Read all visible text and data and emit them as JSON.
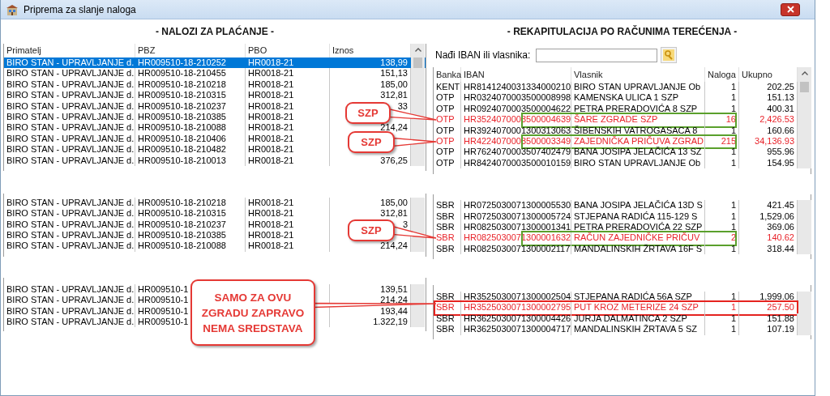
{
  "window": {
    "title": "Priprema za slanje naloga"
  },
  "payments": {
    "heading": "- NALOZI ZA PLAĆANJE -",
    "columns": [
      "Primatelj",
      "PBZ",
      "PBO",
      "Iznos"
    ],
    "strips": [
      {
        "rows": [
          {
            "primatelj": "BIRO STAN - UPRAVLJANJE d.",
            "pbz": "HR009510-18-210252",
            "pbo": "HR0018-21",
            "iznos": "138,99",
            "selected": true
          },
          {
            "primatelj": "BIRO STAN - UPRAVLJANJE d.",
            "pbz": "HR009510-18-210455",
            "pbo": "HR0018-21",
            "iznos": "151,13",
            "selected": false
          },
          {
            "primatelj": "BIRO STAN - UPRAVLJANJE d.",
            "pbz": "HR009510-18-210218",
            "pbo": "HR0018-21",
            "iznos": "185,00",
            "selected": false
          },
          {
            "primatelj": "BIRO STAN - UPRAVLJANJE d.",
            "pbz": "HR009510-18-210315",
            "pbo": "HR0018-21",
            "iznos": "312,81",
            "selected": false
          },
          {
            "primatelj": "BIRO STAN - UPRAVLJANJE d.",
            "pbz": "HR009510-18-210237",
            "pbo": "HR0018-21",
            "iznos": "33",
            "selected": false
          },
          {
            "primatelj": "BIRO STAN - UPRAVLJANJE d.",
            "pbz": "HR009510-18-210385",
            "pbo": "HR0018-21",
            "selected": false
          },
          {
            "primatelj": "BIRO STAN - UPRAVLJANJE d.",
            "pbz": "HR009510-18-210088",
            "pbo": "HR0018-21",
            "iznos": "214,24",
            "selected": false
          },
          {
            "primatelj": "BIRO STAN - UPRAVLJANJE d.",
            "pbz": "HR009510-18-210406",
            "pbo": "HR0018-21",
            "selected": false
          },
          {
            "primatelj": "BIRO STAN - UPRAVLJANJE d.",
            "pbz": "HR009510-18-210482",
            "pbo": "HR0018-21",
            "selected": false
          },
          {
            "primatelj": "BIRO STAN - UPRAVLJANJE d.",
            "pbz": "HR009510-18-210013",
            "pbo": "HR0018-21",
            "iznos": "376,25",
            "selected": false
          }
        ]
      },
      {
        "rows": [
          {
            "primatelj": "BIRO STAN - UPRAVLJANJE d.",
            "pbz": "HR009510-18-210218",
            "pbo": "HR0018-21",
            "iznos": "185,00",
            "selected": false
          },
          {
            "primatelj": "BIRO STAN - UPRAVLJANJE d.",
            "pbz": "HR009510-18-210315",
            "pbo": "HR0018-21",
            "iznos": "312,81",
            "selected": false
          },
          {
            "primatelj": "BIRO STAN - UPRAVLJANJE d.",
            "pbz": "HR009510-18-210237",
            "pbo": "HR0018-21",
            "iznos": "3",
            "selected": false
          },
          {
            "primatelj": "BIRO STAN - UPRAVLJANJE d.",
            "pbz": "HR009510-18-210385",
            "pbo": "HR0018-21",
            "selected": false
          },
          {
            "primatelj": "BIRO STAN - UPRAVLJANJE d.",
            "pbz": "HR009510-18-210088",
            "pbo": "HR0018-21",
            "iznos": "214,24",
            "selected": false
          }
        ]
      },
      {
        "rows": [
          {
            "primatelj": "BIRO STAN - UPRAVLJANJE d.",
            "pbz": "HR009510-1",
            "iznos": "139,51",
            "selected": false
          },
          {
            "primatelj": "BIRO STAN - UPRAVLJANJE d.",
            "pbz": "HR009510-1",
            "iznos": "214,24",
            "selected": false
          },
          {
            "primatelj": "BIRO STAN - UPRAVLJANJE d.",
            "pbz": "HR009510-1",
            "iznos": "193,44",
            "selected": false
          },
          {
            "primatelj": "BIRO STAN - UPRAVLJANJE d.",
            "pbz": "HR009510-1",
            "iznos": "1.322,19",
            "selected": false
          }
        ]
      }
    ]
  },
  "recap": {
    "heading": "- REKAPITULACIJA PO RAČUNIMA TEREĆENJA -",
    "search": {
      "label": "Nađi IBAN ili vlasnika:"
    },
    "columns": [
      "Banka",
      "IBAN",
      "Vlasnik",
      "Naloga",
      "Ukupno"
    ],
    "strips": [
      {
        "rows": [
          {
            "banka": "KENT",
            "iban": "HR8141240031334000210",
            "vlasnik": "BIRO STAN  UPRAVLJANJE Ob",
            "naloga": "1",
            "ukupno": "202.25",
            "flagged": false
          },
          {
            "banka": "OTP",
            "iban": "HR0324070003500008998",
            "vlasnik": "KAMENSKA ULICA 1 SZP",
            "naloga": "1",
            "ukupno": "151.13",
            "flagged": false
          },
          {
            "banka": "OTP",
            "iban": "HR0924070003500004622",
            "vlasnik": "PETRA PRERADOVIĆA 8 SZP",
            "naloga": "1",
            "ukupno": "400.31",
            "flagged": false
          },
          {
            "banka": "OTP",
            "iban": "HR3524070003500004639",
            "vlasnik": "ŠARE ZGRADE SZP",
            "naloga": "16",
            "ukupno": "2,426.53",
            "flagged": true,
            "color": "#5aa02c",
            "frame_whole": false
          },
          {
            "banka": "OTP",
            "iban": "HR3924070001300313063",
            "vlasnik": "ŠIBENSKIH VATROGASACA 8",
            "naloga": "1",
            "ukupno": "160.66",
            "flagged": false
          },
          {
            "banka": "OTP",
            "iban": "HR4224070003500003349",
            "vlasnik": "ZAJEDNIČKA PRIČUVA ZGRAD",
            "naloga": "215",
            "ukupno": "34,136.93",
            "flagged": true,
            "color": "#5aa02c",
            "frame_whole": false
          },
          {
            "banka": "OTP",
            "iban": "HR7624070003507402479",
            "vlasnik": "BANA JOSIPA JELAČIĆA 13 SZ",
            "naloga": "1",
            "ukupno": "955.96",
            "flagged": false
          },
          {
            "banka": "OTP",
            "iban": "HR8424070003500010159",
            "vlasnik": "BIRO STAN  UPRAVLJANJE Ob",
            "naloga": "1",
            "ukupno": "154.95",
            "flagged": false
          }
        ]
      },
      {
        "rows": [
          {
            "banka": "SBR",
            "iban": "HR0725030071300005530",
            "vlasnik": "BANA JOSIPA JELAČIĆA 13D S",
            "naloga": "1",
            "ukupno": "421.45",
            "flagged": false
          },
          {
            "banka": "SBR",
            "iban": "HR0725030071300005724",
            "vlasnik": "STJEPANA RADIĆA 115-129 S",
            "naloga": "1",
            "ukupno": "1,529.06",
            "flagged": false
          },
          {
            "banka": "SBR",
            "iban": "HR0825030071300001341",
            "vlasnik": "PETRA PRERADOVIĆA 22 SZP",
            "naloga": "1",
            "ukupno": "369.06",
            "flagged": false
          },
          {
            "banka": "SBR",
            "iban": "HR0825030071300001632",
            "vlasnik": "RAČUN ZAJEDNIČKE PRIČUV",
            "naloga": "2",
            "ukupno": "140.62",
            "flagged": true,
            "color": "#5aa02c",
            "frame_whole": false
          },
          {
            "banka": "SBR",
            "iban": "HR0825030071300002117",
            "vlasnik": "MANDALINSKIH ŽRTAVA 16F S",
            "naloga": "1",
            "ukupno": "318.44",
            "flagged": false
          }
        ]
      },
      {
        "rows": [
          {
            "banka": "SBR",
            "iban": "HR3525030071300002504",
            "vlasnik": "STJEPANA RADIĆA 56A SZP",
            "naloga": "1",
            "ukupno": "1,999.06",
            "flagged": false
          },
          {
            "banka": "SBR",
            "iban": "HR3525030071300002795",
            "vlasnik": "PUT KROZ METERIZE 24 SZP",
            "naloga": "1",
            "ukupno": "257.50",
            "flagged": true,
            "color": "#e5231f",
            "frame_whole": true
          },
          {
            "banka": "SBR",
            "iban": "HR3625030071300004426",
            "vlasnik": "JURJA DALMATINCA 2 SZP",
            "naloga": "1",
            "ukupno": "151.88",
            "flagged": false
          },
          {
            "banka": "SBR",
            "iban": "HR3625030071300004717",
            "vlasnik": "MANDALINSKIH ŽRTAVA 5 SZ",
            "naloga": "1",
            "ukupno": "107.19",
            "flagged": false
          }
        ]
      }
    ]
  },
  "callouts": [
    {
      "text": "SZP"
    },
    {
      "text": "SZP"
    },
    {
      "text": "SZP"
    },
    {
      "text": "SAMO ZA OVU ZGRADU ZAPRAVO NEMA SREDSTAVA"
    }
  ]
}
